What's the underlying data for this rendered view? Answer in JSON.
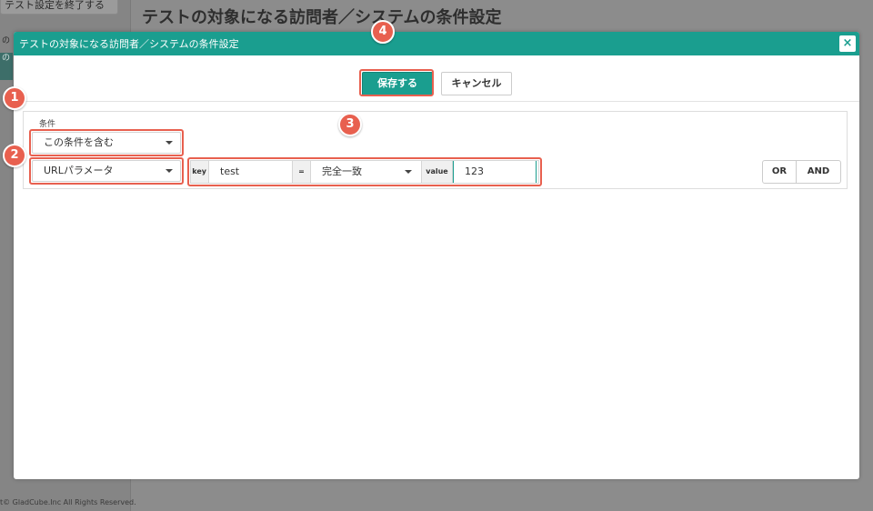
{
  "background": {
    "end_test_button": "テスト設定を終了する",
    "page_title": "テストの対象になる訪問者／システムの条件設定",
    "sidebar_fragment_a": "の",
    "sidebar_fragment_b": "の",
    "copyright": "t© GladCube.Inc All Rights Reserved."
  },
  "modal": {
    "title": "テストの対象になる訪問者／システムの条件設定",
    "close_label": "×",
    "save_label": "保存する",
    "cancel_label": "キャンセル",
    "condition_section_label": "条件",
    "include_select": {
      "selected": "この条件を含む"
    },
    "parameter_select": {
      "selected": "URLパラメータ"
    },
    "condition": {
      "key_label": "key",
      "key_value": "test",
      "operator": "=",
      "match_select": "完全一致",
      "value_label": "value",
      "value_value": "123"
    },
    "or_label": "OR",
    "and_label": "AND"
  },
  "annotations": {
    "marker_1": "1",
    "marker_2": "2",
    "marker_3": "3",
    "marker_4": "4",
    "highlight_color": "#e8604f"
  },
  "colors": {
    "accent": "#1a9e8f"
  }
}
